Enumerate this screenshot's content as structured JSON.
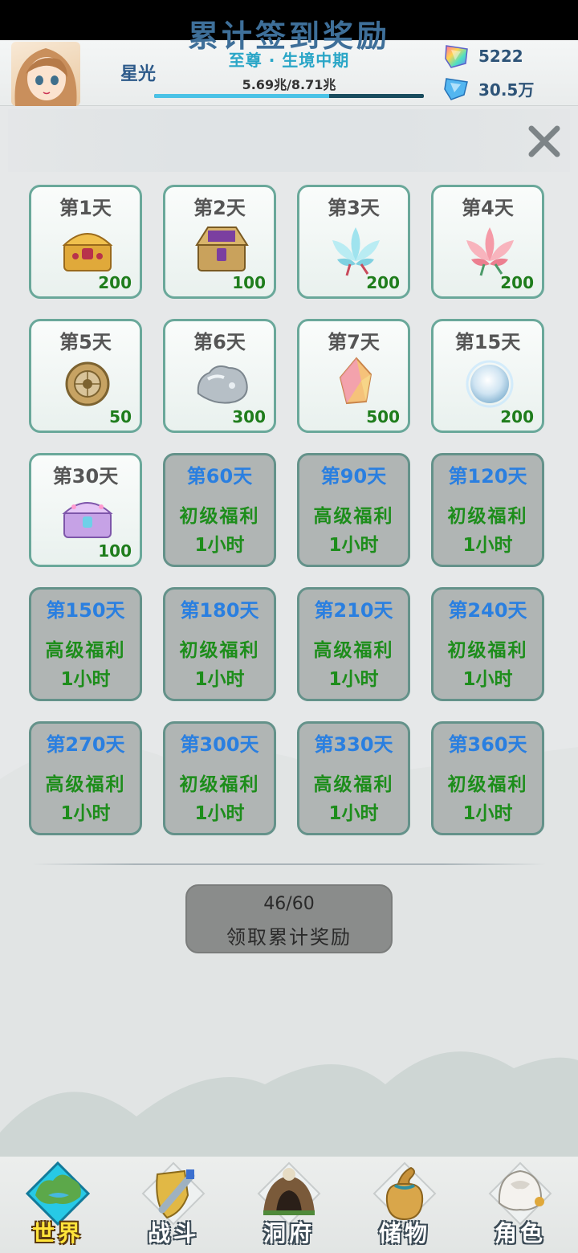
{
  "header": {
    "player_name": "星光",
    "realm": "至尊 · 生境中期",
    "exp_text": "5.69兆/8.71兆",
    "exp_progress": 0.65,
    "currencies": [
      {
        "icon": "rainbow-gem-icon",
        "value": "5222"
      },
      {
        "icon": "blue-diamond-icon",
        "value": "30.5万"
      }
    ]
  },
  "title": "累计签到奖励",
  "rewards": [
    {
      "day": "第1天",
      "icon": "golden-treasure-chest-icon",
      "qty": "200"
    },
    {
      "day": "第2天",
      "icon": "ornate-chest-icon",
      "qty": "100"
    },
    {
      "day": "第3天",
      "icon": "blue-lotus-icon",
      "qty": "200"
    },
    {
      "day": "第4天",
      "icon": "pink-lotus-icon",
      "qty": "200"
    },
    {
      "day": "第5天",
      "icon": "bronze-medallion-icon",
      "qty": "50"
    },
    {
      "day": "第6天",
      "icon": "silver-ore-icon",
      "qty": "300"
    },
    {
      "day": "第7天",
      "icon": "crystal-icon",
      "qty": "500"
    },
    {
      "day": "第15天",
      "icon": "spirit-orb-icon",
      "qty": "200"
    },
    {
      "day": "第30天",
      "icon": "purple-chest-icon",
      "qty": "100"
    }
  ],
  "locked_rewards": [
    {
      "day": "第60天",
      "reward": "初级福利",
      "duration": "1小时"
    },
    {
      "day": "第90天",
      "reward": "高级福利",
      "duration": "1小时"
    },
    {
      "day": "第120天",
      "reward": "初级福利",
      "duration": "1小时"
    },
    {
      "day": "第150天",
      "reward": "高级福利",
      "duration": "1小时"
    },
    {
      "day": "第180天",
      "reward": "初级福利",
      "duration": "1小时"
    },
    {
      "day": "第210天",
      "reward": "高级福利",
      "duration": "1小时"
    },
    {
      "day": "第240天",
      "reward": "初级福利",
      "duration": "1小时"
    },
    {
      "day": "第270天",
      "reward": "高级福利",
      "duration": "1小时"
    },
    {
      "day": "第300天",
      "reward": "初级福利",
      "duration": "1小时"
    },
    {
      "day": "第330天",
      "reward": "高级福利",
      "duration": "1小时"
    },
    {
      "day": "第360天",
      "reward": "初级福利",
      "duration": "1小时"
    }
  ],
  "claim": {
    "progress": "46/60",
    "label": "领取累计奖励"
  },
  "nav": [
    {
      "label": "世界",
      "icon": "world-island-icon",
      "active": true
    },
    {
      "label": "战斗",
      "icon": "sword-shield-icon",
      "active": false
    },
    {
      "label": "洞府",
      "icon": "cave-icon",
      "active": false
    },
    {
      "label": "储物",
      "icon": "gourd-bag-icon",
      "active": false
    },
    {
      "label": "角色",
      "icon": "helmet-icon",
      "active": false
    }
  ]
}
